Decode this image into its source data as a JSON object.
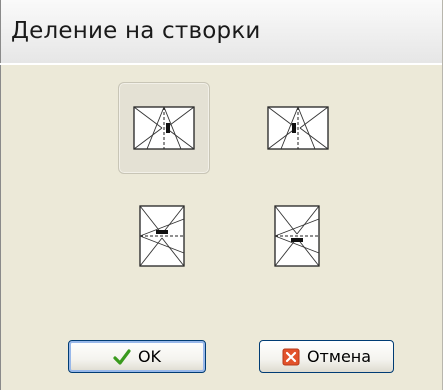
{
  "window": {
    "title": "Деление на створки"
  },
  "options": [
    {
      "name": "vertical-split-left-hinge",
      "selected": true
    },
    {
      "name": "vertical-split-right-hinge",
      "selected": false
    },
    {
      "name": "horizontal-split-top-hinge",
      "selected": false
    },
    {
      "name": "horizontal-split-bottom-hinge",
      "selected": false
    }
  ],
  "buttons": {
    "ok_label": "OK",
    "cancel_label": "Отмена"
  },
  "icons": {
    "ok": "checkmark-icon",
    "cancel": "close-x-icon"
  },
  "colors": {
    "dialog_background": "#ECE9D8",
    "ok_icon": "#3a9a1e",
    "cancel_icon": "#e2522b"
  }
}
